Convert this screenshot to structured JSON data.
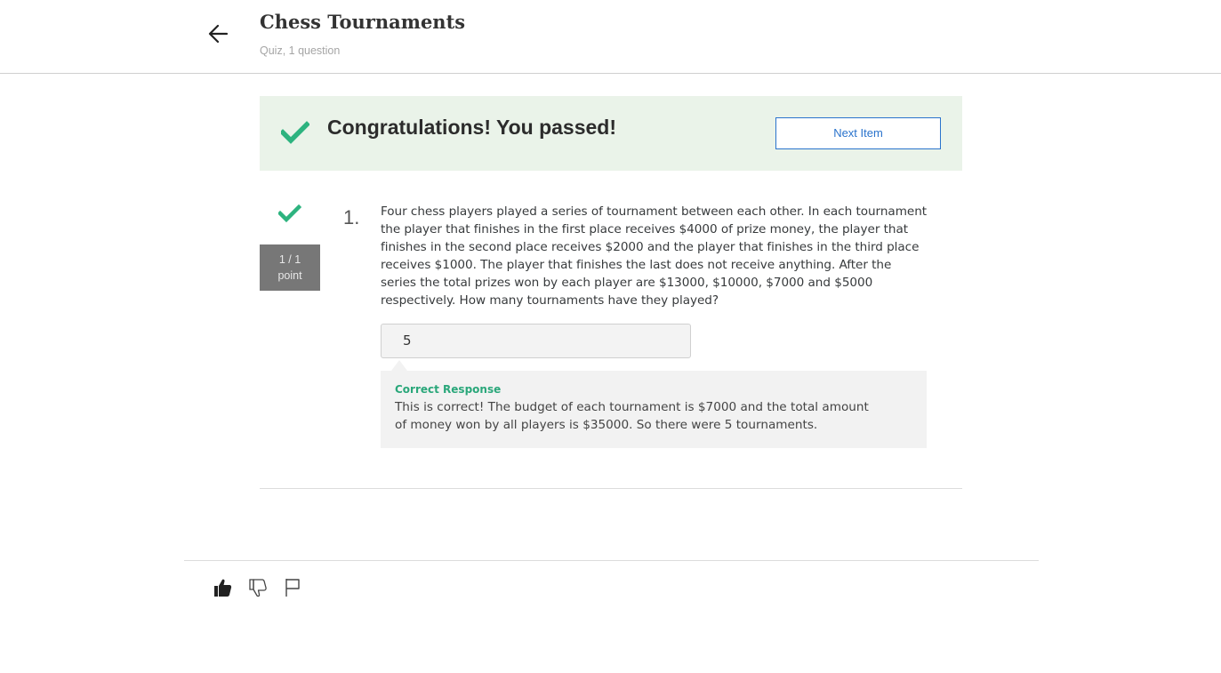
{
  "header": {
    "title": "Chess Tournaments",
    "subtitle": "Quiz, 1 question",
    "back_icon": "arrow-left-icon"
  },
  "banner": {
    "icon": "checkmark-icon",
    "message": "Congratulations! You passed!",
    "next_button_label": "Next Item"
  },
  "question": {
    "status_icon": "checkmark-icon",
    "points_line1": "1 / 1",
    "points_line2": "point",
    "number": "1.",
    "text": "Four chess players played a series of tournament between each other. In each tournament the player that finishes in the first place receives $4000 of prize money, the player that finishes in the second place receives $2000 and the player that finishes in the third place receives $1000. The player that finishes the last does not receive anything. After the series the total prizes won by each player are $13000, $10000, $7000 and $5000 respectively. How many tournaments have they played?",
    "answer_value": "5",
    "feedback_title": "Correct Response",
    "feedback_text": "This is correct! The budget of each tournament is $7000 and the total amount of money won by all players is $35000. So there were 5 tournaments."
  },
  "footer": {
    "icons": [
      "thumbs-up-icon",
      "thumbs-down-icon",
      "flag-icon"
    ]
  },
  "colors": {
    "success_green": "#2db37f",
    "banner_bg": "#eaf3e9",
    "link_blue": "#2a73cc",
    "badge_gray": "#777777"
  }
}
